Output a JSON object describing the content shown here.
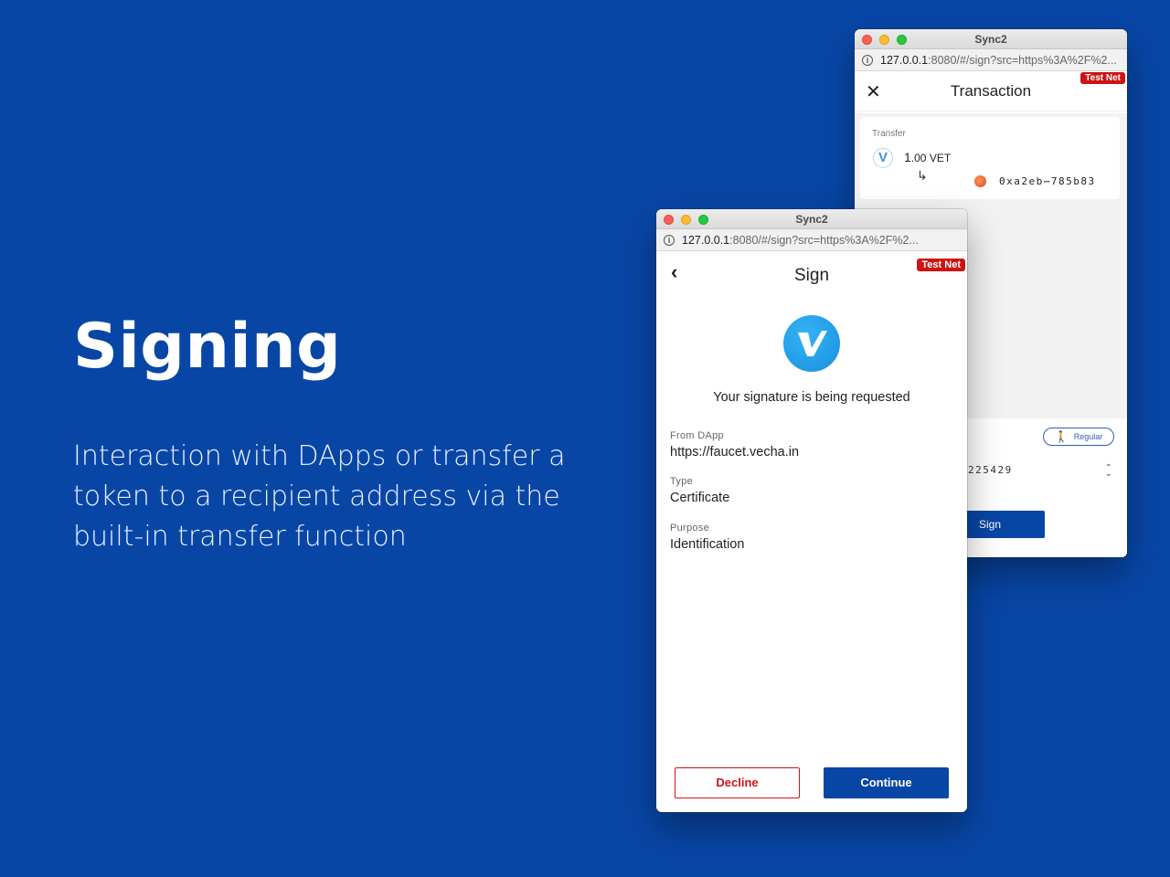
{
  "hero": {
    "title": "Signing",
    "description": "Interaction with DApps or transfer a token to a recipient address via the built-in transfer function"
  },
  "back_window": {
    "window_title": "Sync2",
    "url_host": "127.0.0.1",
    "url_rest": ":8080/#/sign?src=https%3A%2F%2...",
    "badge": "Test Net",
    "header_title": "Transaction",
    "transfer": {
      "label": "Transfer",
      "amount_major": "1",
      "amount_minor": ".00 VET",
      "to_address": "0xa2eb⋯785b83"
    },
    "gas": {
      "priority_label": "Regular",
      "value": "225429"
    },
    "sign_label": "Sign"
  },
  "front_window": {
    "window_title": "Sync2",
    "url_host": "127.0.0.1",
    "url_rest": ":8080/#/sign?src=https%3A%2F%2...",
    "badge": "Test Net",
    "header_title": "Sign",
    "request_text": "Your signature is being requested",
    "fields": [
      {
        "label": "From DApp",
        "value": "https://faucet.vecha.in"
      },
      {
        "label": "Type",
        "value": "Certificate"
      },
      {
        "label": "Purpose",
        "value": "Identification"
      }
    ],
    "decline_label": "Decline",
    "continue_label": "Continue"
  },
  "colors": {
    "background": "#0846a6",
    "accent": "#0846a6",
    "danger": "#cc1414",
    "vet_logo": "#1f9ef0"
  },
  "icons": [
    "close-icon",
    "back-chevron-icon",
    "info-icon",
    "vechain-logo-icon",
    "return-arrow-icon",
    "walking-person-icon",
    "stepper-icon"
  ]
}
